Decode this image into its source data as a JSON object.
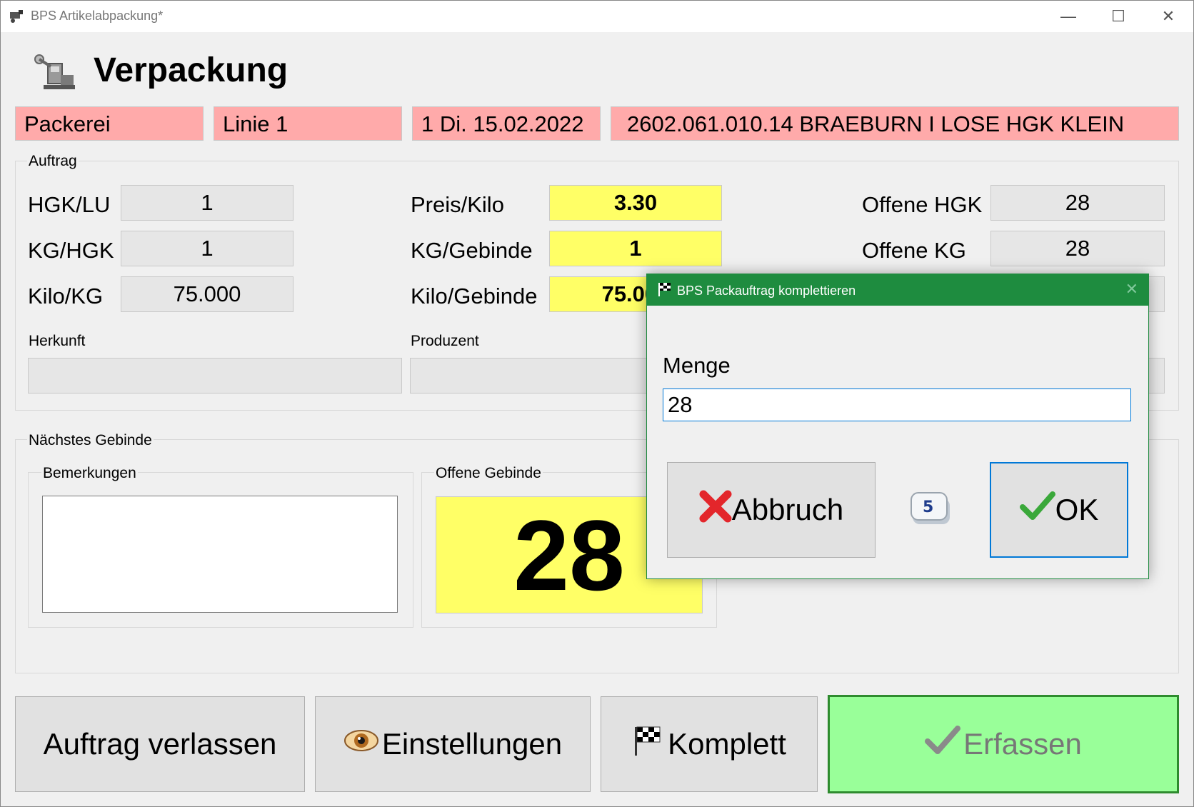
{
  "window": {
    "title": "BPS Artikelabpackung*",
    "controls": {
      "minimize": "—",
      "maximize": "☐",
      "close": "✕"
    }
  },
  "header": {
    "title": "Verpackung"
  },
  "banner": {
    "location": "Packerei",
    "line": "Linie 1",
    "date": "1 Di. 15.02.2022",
    "article": "2602.061.010.14 BRAEBURN I LOSE HGK KLEIN"
  },
  "auftrag": {
    "label": "Auftrag",
    "fields": {
      "hgk_lu": {
        "label": "HGK/LU",
        "value": "1"
      },
      "kg_hgk": {
        "label": "KG/HGK",
        "value": "1"
      },
      "kilo_kg": {
        "label": "Kilo/KG",
        "value": "75.000"
      },
      "preis_kilo": {
        "label": "Preis/Kilo",
        "value": "3.30"
      },
      "kg_gebinde": {
        "label": "KG/Gebinde",
        "value": "1"
      },
      "kilo_gebinde": {
        "label": "Kilo/Gebinde",
        "value": "75.000"
      },
      "offene_hgk": {
        "label": "Offene HGK",
        "value": "28"
      },
      "offene_kg": {
        "label": "Offene KG",
        "value": "28"
      }
    },
    "herkunft": {
      "label": "Herkunft",
      "value": ""
    },
    "produzent": {
      "label": "Produzent",
      "value": ""
    }
  },
  "naechstes": {
    "label": "Nächstes Gebinde",
    "bemerkungen": {
      "label": "Bemerkungen",
      "value": ""
    },
    "offene_gebinde": {
      "label": "Offene Gebinde",
      "value": "28"
    }
  },
  "buttons": {
    "verlassen": "Auftrag verlassen",
    "einstellungen": "Einstellungen",
    "komplett": "Komplett",
    "erfassen": "Erfassen"
  },
  "dialog": {
    "title": "BPS Packauftrag komplettieren",
    "close": "✕",
    "menge_label": "Menge",
    "menge_value": "28",
    "abbruch": "Abbruch",
    "ok": "OK",
    "keypad_key": "5"
  },
  "colors": {
    "banner": "#ffaaaa",
    "highlight": "#ffff66",
    "erfassen": "#99ff99",
    "dialog_title": "#1e8c3f"
  }
}
